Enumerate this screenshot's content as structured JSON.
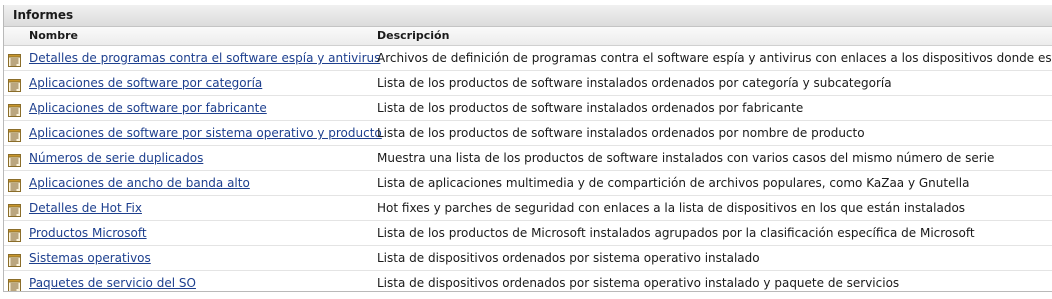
{
  "panel": {
    "title": "Informes"
  },
  "columns": {
    "name": "Nombre",
    "description": "Descripción"
  },
  "rows": [
    {
      "name": "Detalles de programas contra el software espía y antivirus",
      "description": "Archivos de definición de programas contra el software espía y antivirus con enlaces a los dispositivos donde están"
    },
    {
      "name": "Aplicaciones de software por categoría",
      "description": "Lista de los productos de software instalados ordenados por categoría y subcategoría"
    },
    {
      "name": "Aplicaciones de software por fabricante",
      "description": "Lista de los productos de software instalados ordenados por fabricante"
    },
    {
      "name": "Aplicaciones de software por sistema operativo y producto",
      "description": "Lista de los productos de software instalados ordenados por nombre de producto"
    },
    {
      "name": "Números de serie duplicados",
      "description": "Muestra una lista de los productos de software instalados con varios casos del mismo número de serie"
    },
    {
      "name": "Aplicaciones de ancho de banda alto",
      "description": "Lista de aplicaciones multimedia y de compartición de archivos populares, como KaZaa y Gnutella"
    },
    {
      "name": "Detalles de Hot Fix",
      "description": "Hot fixes y parches de seguridad con enlaces a la lista de dispositivos en los que están instalados"
    },
    {
      "name": "Productos Microsoft",
      "description": "Lista de los productos de Microsoft instalados agrupados por la clasificación específica de Microsoft"
    },
    {
      "name": "Sistemas operativos",
      "description": "Lista de dispositivos ordenados por sistema operativo instalado"
    },
    {
      "name": "Paquetes de servicio del SO",
      "description": "Lista de dispositivos ordenados por sistema operativo instalado y paquete de servicios"
    }
  ],
  "icons": {
    "row_icon": "report-icon"
  },
  "colors": {
    "link": "#1d3f8e",
    "icon_accent": "#c8962c"
  }
}
